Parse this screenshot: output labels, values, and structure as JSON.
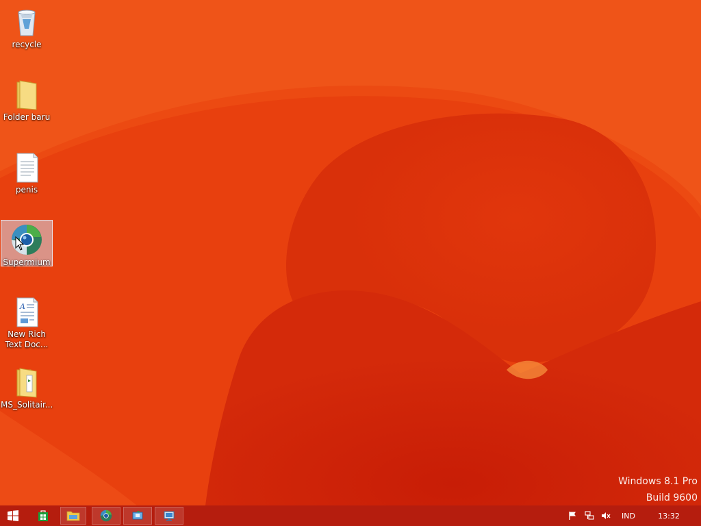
{
  "desktop": {
    "icons": [
      {
        "label": "recycle",
        "icon": "recycle-bin-icon"
      },
      {
        "label": "Folder baru",
        "icon": "folder-icon"
      },
      {
        "label": "penis",
        "icon": "text-file-icon"
      },
      {
        "label": "Supermium",
        "icon": "supermium-browser-icon",
        "selected": true
      },
      {
        "label": "New Rich Text Doc...",
        "label_lines": [
          "New Rich",
          "Text Doc..."
        ],
        "icon": "rich-text-document-icon"
      },
      {
        "label": "MS_Solitair...",
        "icon": "zip-folder-icon"
      }
    ]
  },
  "watermark": {
    "line1": "Windows 8.1 Pro",
    "line2": "Build 9600"
  },
  "taskbar": {
    "start": "windows-start-icon",
    "buttons": [
      {
        "name": "store",
        "icon": "windows-store-icon"
      },
      {
        "name": "file-explorer",
        "icon": "file-explorer-icon",
        "running": true
      },
      {
        "name": "supermium",
        "icon": "supermium-browser-icon",
        "running": true
      },
      {
        "name": "app",
        "icon": "app-window-icon",
        "running": true
      },
      {
        "name": "remote",
        "icon": "remote-desktop-icon",
        "running": true
      }
    ],
    "tray": {
      "language": "IND",
      "time": "13:32"
    }
  },
  "colors": {
    "wallpaper_base": "#e8430f",
    "wallpaper_dark": "#d42a0a",
    "wallpaper_light": "#f2632a",
    "taskbar": "#b51d0e",
    "store_green": "#1a9e3a"
  }
}
